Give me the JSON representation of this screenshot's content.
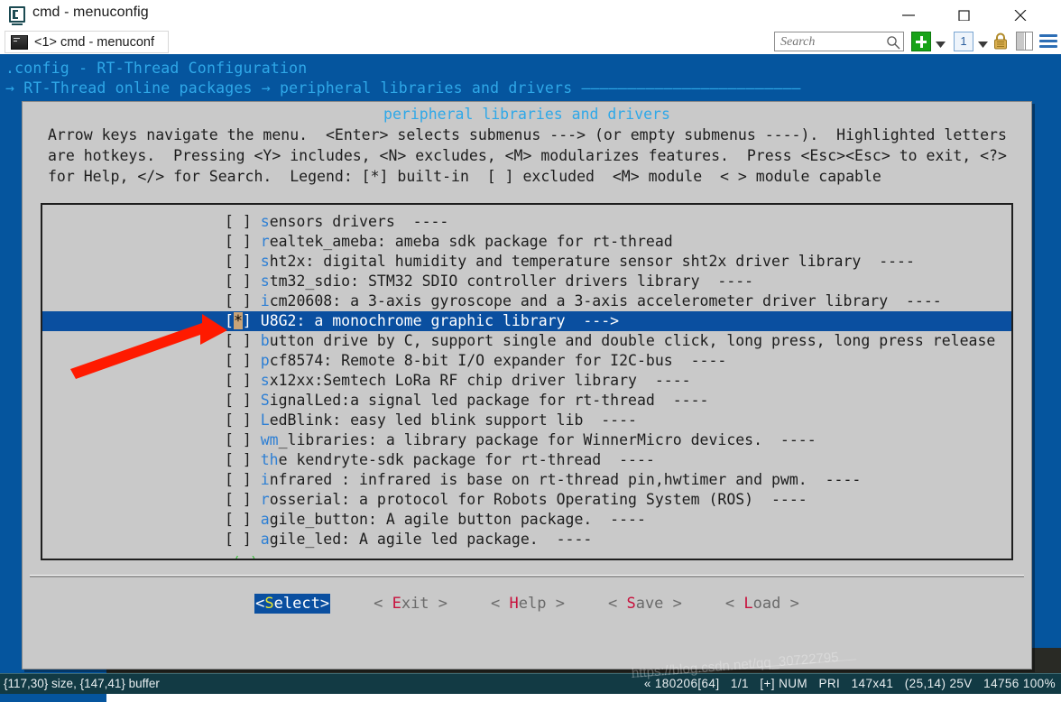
{
  "window": {
    "title": "cmd - menuconfig",
    "app_icon": "terminal-icon",
    "minimize_label": "Minimize",
    "maximize_label": "Maximize",
    "close_label": "Close"
  },
  "tabstrip": {
    "tabs": [
      {
        "label": "<1> cmd - menuconf",
        "icon": "console-icon"
      }
    ],
    "search": {
      "value": "",
      "placeholder": "Search",
      "icon": "search-icon"
    },
    "toolbar": [
      {
        "name": "new-tab-button",
        "icon": "plus-icon",
        "color": "#19a319"
      },
      {
        "name": "new-tab-dropdown",
        "icon": "chevron-down-icon"
      },
      {
        "name": "tab-index-button",
        "icon": "number-box-icon",
        "label": "1"
      },
      {
        "name": "tab-index-dropdown",
        "icon": "chevron-down-icon"
      },
      {
        "name": "lock-button",
        "icon": "lock-icon"
      },
      {
        "name": "split-panes-button",
        "icon": "panes-icon"
      },
      {
        "name": "menu-button",
        "icon": "hamburger-icon"
      }
    ]
  },
  "terminal": {
    "header": {
      "line1": ".config - RT-Thread Configuration",
      "line2_prefix": "→ ",
      "line2_a": "RT-Thread online packages",
      "line2_arrow": " → ",
      "line2_b": "peripheral libraries and drivers",
      "line2_rule": " ————————————————————————"
    },
    "dialog": {
      "title": "peripheral libraries and drivers",
      "help_line1": "Arrow keys navigate the menu.  <Enter> selects submenus ---> (or empty submenus ----).  Highlighted letters",
      "help_line2": "are hotkeys.  Pressing <Y> includes, <N> excludes, <M> modularizes features.  Press <Esc><Esc> to exit, <?>",
      "help_line3": "for Help, </> for Search.  Legend: [*] built-in  [ ] excluded  <M> module  < > module capable",
      "scroll_hint": "↓(+)",
      "items": [
        {
          "checkbox": "[ ]",
          "checked": false,
          "hotkey": "s",
          "rest": "ensors drivers  ----",
          "selected": false
        },
        {
          "checkbox": "[ ]",
          "checked": false,
          "hotkey": "r",
          "rest": "ealtek_ameba: ameba sdk package for rt-thread",
          "selected": false
        },
        {
          "checkbox": "[ ]",
          "checked": false,
          "hotkey": "s",
          "rest": "ht2x: digital humidity and temperature sensor sht2x driver library  ----",
          "selected": false
        },
        {
          "checkbox": "[ ]",
          "checked": false,
          "hotkey": "s",
          "rest": "tm32_sdio: STM32 SDIO controller drivers library  ----",
          "selected": false
        },
        {
          "checkbox": "[ ]",
          "checked": false,
          "hotkey": "i",
          "rest": "cm20608: a 3-axis gyroscope and a 3-axis accelerometer driver library  ----",
          "selected": false
        },
        {
          "checkbox": "[*]",
          "checked": true,
          "hotkey": "U",
          "rest": "8G2: a monochrome graphic library  --->",
          "selected": true
        },
        {
          "checkbox": "[ ]",
          "checked": false,
          "hotkey": "b",
          "rest": "utton drive by C, support single and double click, long press, long press release  -",
          "selected": false
        },
        {
          "checkbox": "[ ]",
          "checked": false,
          "hotkey": "p",
          "rest": "cf8574: Remote 8-bit I/O expander for I2C-bus  ----",
          "selected": false
        },
        {
          "checkbox": "[ ]",
          "checked": false,
          "hotkey": "s",
          "rest": "x12xx:Semtech LoRa RF chip driver library  ----",
          "selected": false
        },
        {
          "checkbox": "[ ]",
          "checked": false,
          "hotkey": "S",
          "rest": "ignalLed:a signal led package for rt-thread  ----",
          "selected": false
        },
        {
          "checkbox": "[ ]",
          "checked": false,
          "hotkey": "L",
          "rest": "edBlink: easy led blink support lib  ----",
          "selected": false
        },
        {
          "checkbox": "[ ]",
          "checked": false,
          "hotkey": "wm",
          "rest": "_libraries: a library package for WinnerMicro devices.  ----",
          "selected": false
        },
        {
          "checkbox": "[ ]",
          "checked": false,
          "hotkey": "th",
          "rest": "e kendryte-sdk package for rt-thread  ----",
          "selected": false
        },
        {
          "checkbox": "[ ]",
          "checked": false,
          "hotkey": "i",
          "rest": "nfrared : infrared is base on rt-thread pin,hwtimer and pwm.  ----",
          "selected": false
        },
        {
          "checkbox": "[ ]",
          "checked": false,
          "hotkey": "r",
          "rest": "osserial: a protocol for Robots Operating System (ROS)  ----",
          "selected": false
        },
        {
          "checkbox": "[ ]",
          "checked": false,
          "hotkey": "a",
          "rest": "gile_button: A agile button package.  ----",
          "selected": false
        },
        {
          "checkbox": "[ ]",
          "checked": false,
          "hotkey": "a",
          "rest": "gile_led: A agile led package.  ----",
          "selected": false
        }
      ],
      "buttons": [
        {
          "name": "select-button",
          "open": "<",
          "hot": "S",
          "rest": "elect",
          "close": ">",
          "active": true
        },
        {
          "name": "exit-button",
          "open": "<",
          "hot": "E",
          "rest": "xit",
          "close": ">",
          "active": false
        },
        {
          "name": "help-button",
          "open": "<",
          "hot": "H",
          "rest": "elp",
          "close": ">",
          "active": false
        },
        {
          "name": "save-button",
          "open": "<",
          "hot": "S",
          "rest": "ave",
          "close": ">",
          "active": false
        },
        {
          "name": "load-button",
          "open": "<",
          "hot": "L",
          "rest": "oad",
          "close": ">",
          "active": false
        }
      ]
    }
  },
  "statusbar": {
    "left": "{117,30} size, {147,41} buffer",
    "right": "« 180206[64]   1/1   [+] NUM   PRI   147x41   (25,14) 25V   14756 100%"
  },
  "watermark": {
    "text": "https://blog.csdn.net/qq_30722795"
  },
  "colors": {
    "terminal_blue": "#05559e",
    "dialog_grey": "#c9c9c9",
    "selection_blue": "#0a4fa0",
    "hotkey_blue": "#2d7fd4",
    "hotkey_red": "#c8103c",
    "hotkey_yellow": "#e8e830",
    "title_cyan": "#2fa8e8",
    "scroll_green": "#3fc23f",
    "checkbox_star_bg": "#c9a478",
    "annotation_red": "#ff1a00",
    "statusbar_bg": "#123a44"
  }
}
